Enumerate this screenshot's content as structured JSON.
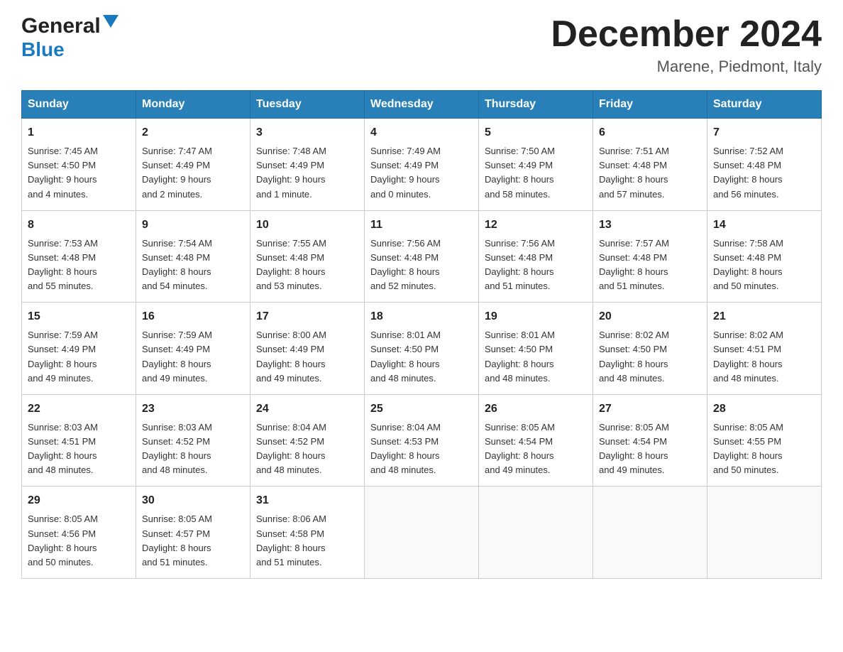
{
  "header": {
    "logo_general": "General",
    "logo_blue": "Blue",
    "month_title": "December 2024",
    "location": "Marene, Piedmont, Italy"
  },
  "days_of_week": [
    "Sunday",
    "Monday",
    "Tuesday",
    "Wednesday",
    "Thursday",
    "Friday",
    "Saturday"
  ],
  "weeks": [
    [
      {
        "day": "1",
        "sunrise": "7:45 AM",
        "sunset": "4:50 PM",
        "daylight": "9 hours and 4 minutes."
      },
      {
        "day": "2",
        "sunrise": "7:47 AM",
        "sunset": "4:49 PM",
        "daylight": "9 hours and 2 minutes."
      },
      {
        "day": "3",
        "sunrise": "7:48 AM",
        "sunset": "4:49 PM",
        "daylight": "9 hours and 1 minute."
      },
      {
        "day": "4",
        "sunrise": "7:49 AM",
        "sunset": "4:49 PM",
        "daylight": "9 hours and 0 minutes."
      },
      {
        "day": "5",
        "sunrise": "7:50 AM",
        "sunset": "4:49 PM",
        "daylight": "8 hours and 58 minutes."
      },
      {
        "day": "6",
        "sunrise": "7:51 AM",
        "sunset": "4:48 PM",
        "daylight": "8 hours and 57 minutes."
      },
      {
        "day": "7",
        "sunrise": "7:52 AM",
        "sunset": "4:48 PM",
        "daylight": "8 hours and 56 minutes."
      }
    ],
    [
      {
        "day": "8",
        "sunrise": "7:53 AM",
        "sunset": "4:48 PM",
        "daylight": "8 hours and 55 minutes."
      },
      {
        "day": "9",
        "sunrise": "7:54 AM",
        "sunset": "4:48 PM",
        "daylight": "8 hours and 54 minutes."
      },
      {
        "day": "10",
        "sunrise": "7:55 AM",
        "sunset": "4:48 PM",
        "daylight": "8 hours and 53 minutes."
      },
      {
        "day": "11",
        "sunrise": "7:56 AM",
        "sunset": "4:48 PM",
        "daylight": "8 hours and 52 minutes."
      },
      {
        "day": "12",
        "sunrise": "7:56 AM",
        "sunset": "4:48 PM",
        "daylight": "8 hours and 51 minutes."
      },
      {
        "day": "13",
        "sunrise": "7:57 AM",
        "sunset": "4:48 PM",
        "daylight": "8 hours and 51 minutes."
      },
      {
        "day": "14",
        "sunrise": "7:58 AM",
        "sunset": "4:48 PM",
        "daylight": "8 hours and 50 minutes."
      }
    ],
    [
      {
        "day": "15",
        "sunrise": "7:59 AM",
        "sunset": "4:49 PM",
        "daylight": "8 hours and 49 minutes."
      },
      {
        "day": "16",
        "sunrise": "7:59 AM",
        "sunset": "4:49 PM",
        "daylight": "8 hours and 49 minutes."
      },
      {
        "day": "17",
        "sunrise": "8:00 AM",
        "sunset": "4:49 PM",
        "daylight": "8 hours and 49 minutes."
      },
      {
        "day": "18",
        "sunrise": "8:01 AM",
        "sunset": "4:50 PM",
        "daylight": "8 hours and 48 minutes."
      },
      {
        "day": "19",
        "sunrise": "8:01 AM",
        "sunset": "4:50 PM",
        "daylight": "8 hours and 48 minutes."
      },
      {
        "day": "20",
        "sunrise": "8:02 AM",
        "sunset": "4:50 PM",
        "daylight": "8 hours and 48 minutes."
      },
      {
        "day": "21",
        "sunrise": "8:02 AM",
        "sunset": "4:51 PM",
        "daylight": "8 hours and 48 minutes."
      }
    ],
    [
      {
        "day": "22",
        "sunrise": "8:03 AM",
        "sunset": "4:51 PM",
        "daylight": "8 hours and 48 minutes."
      },
      {
        "day": "23",
        "sunrise": "8:03 AM",
        "sunset": "4:52 PM",
        "daylight": "8 hours and 48 minutes."
      },
      {
        "day": "24",
        "sunrise": "8:04 AM",
        "sunset": "4:52 PM",
        "daylight": "8 hours and 48 minutes."
      },
      {
        "day": "25",
        "sunrise": "8:04 AM",
        "sunset": "4:53 PM",
        "daylight": "8 hours and 48 minutes."
      },
      {
        "day": "26",
        "sunrise": "8:05 AM",
        "sunset": "4:54 PM",
        "daylight": "8 hours and 49 minutes."
      },
      {
        "day": "27",
        "sunrise": "8:05 AM",
        "sunset": "4:54 PM",
        "daylight": "8 hours and 49 minutes."
      },
      {
        "day": "28",
        "sunrise": "8:05 AM",
        "sunset": "4:55 PM",
        "daylight": "8 hours and 50 minutes."
      }
    ],
    [
      {
        "day": "29",
        "sunrise": "8:05 AM",
        "sunset": "4:56 PM",
        "daylight": "8 hours and 50 minutes."
      },
      {
        "day": "30",
        "sunrise": "8:05 AM",
        "sunset": "4:57 PM",
        "daylight": "8 hours and 51 minutes."
      },
      {
        "day": "31",
        "sunrise": "8:06 AM",
        "sunset": "4:58 PM",
        "daylight": "8 hours and 51 minutes."
      },
      null,
      null,
      null,
      null
    ]
  ],
  "labels": {
    "sunrise": "Sunrise:",
    "sunset": "Sunset:",
    "daylight": "Daylight:"
  }
}
